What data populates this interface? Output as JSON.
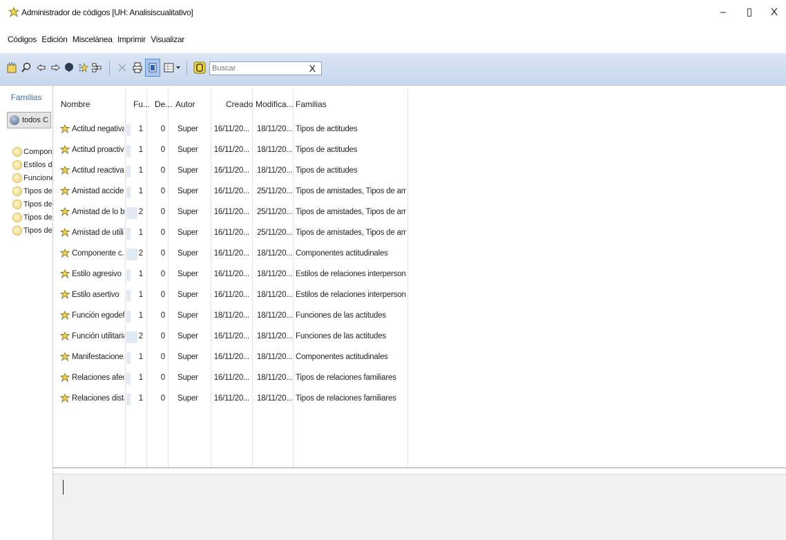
{
  "window": {
    "title": "Administrador de códigos [UH: Analisiscualitativo]",
    "minimize": "–",
    "restore": "▯",
    "close": "X"
  },
  "menu": [
    "Códigos",
    "Edición",
    "Miscelánea",
    "Imprimir",
    "Visualizar"
  ],
  "toolbar": {
    "icons": [
      "new-code-icon",
      "find-icon",
      "back-icon",
      "forward-icon",
      "balloon-icon",
      "quotations-icon",
      "network-icon",
      "delete-icon",
      "print-icon",
      "view-single-icon",
      "view-grid-icon",
      "filter-icon"
    ],
    "search_placeholder": "Buscar",
    "search_clear": "X"
  },
  "sidebar": {
    "title": "Familias",
    "all_button": "todos C",
    "items": [
      "Compone",
      "Estilos de",
      "Funciones",
      "Tipos de a",
      "Tipos de a",
      "Tipos de a",
      "Tipos de r"
    ]
  },
  "table": {
    "headers": [
      "Nombre",
      "Fu...",
      "De...",
      "Autor",
      "Creado",
      "Modifica...",
      "Familias"
    ],
    "rows": [
      {
        "nombre": "Actitud negativa",
        "fu": "1",
        "de": "0",
        "autor": "Super",
        "creado": "16/11/20...",
        "modificado": "18/11/20...",
        "familias": "Tipos de actitudes"
      },
      {
        "nombre": "Actitud proactiva",
        "fu": "1",
        "de": "0",
        "autor": "Super",
        "creado": "16/11/20...",
        "modificado": "18/11/20...",
        "familias": "Tipos de actitudes"
      },
      {
        "nombre": "Actitud reactiva",
        "fu": "1",
        "de": "0",
        "autor": "Super",
        "creado": "16/11/20...",
        "modificado": "18/11/20...",
        "familias": "Tipos de actitudes"
      },
      {
        "nombre": "Amistad accide...",
        "fu": "1",
        "de": "0",
        "autor": "Super",
        "creado": "16/11/20...",
        "modificado": "25/11/20...",
        "familias": "Tipos de amistades, Tipos de ami..."
      },
      {
        "nombre": "Amistad de lo b...",
        "fu": "2",
        "de": "0",
        "autor": "Super",
        "creado": "16/11/20...",
        "modificado": "25/11/20...",
        "familias": "Tipos de amistades, Tipos de ami..."
      },
      {
        "nombre": "Amistad de utili...",
        "fu": "1",
        "de": "0",
        "autor": "Super",
        "creado": "16/11/20...",
        "modificado": "25/11/20...",
        "familias": "Tipos de amistades, Tipos de ami..."
      },
      {
        "nombre": "Componente c...",
        "fu": "2",
        "de": "0",
        "autor": "Super",
        "creado": "16/11/20...",
        "modificado": "18/11/20...",
        "familias": "Componentes actitudinales"
      },
      {
        "nombre": "Estilo agresivo",
        "fu": "1",
        "de": "0",
        "autor": "Super",
        "creado": "16/11/20...",
        "modificado": "18/11/20...",
        "familias": "Estilos de relaciones interpersonal..."
      },
      {
        "nombre": "Estilo asertivo",
        "fu": "1",
        "de": "0",
        "autor": "Super",
        "creado": "16/11/20...",
        "modificado": "18/11/20...",
        "familias": "Estilos de relaciones interpersonal..."
      },
      {
        "nombre": "Función egodef...",
        "fu": "1",
        "de": "0",
        "autor": "Super",
        "creado": "18/11/20...",
        "modificado": "18/11/20...",
        "familias": "Funciones de las actitudes"
      },
      {
        "nombre": "Función utilitaria",
        "fu": "2",
        "de": "0",
        "autor": "Super",
        "creado": "16/11/20...",
        "modificado": "18/11/20...",
        "familias": "Funciones de las actitudes"
      },
      {
        "nombre": "Manifestacione...",
        "fu": "1",
        "de": "0",
        "autor": "Super",
        "creado": "16/11/20...",
        "modificado": "18/11/20...",
        "familias": "Componentes actitudinales"
      },
      {
        "nombre": "Relaciones afect...",
        "fu": "1",
        "de": "0",
        "autor": "Super",
        "creado": "16/11/20...",
        "modificado": "18/11/20...",
        "familias": "Tipos de relaciones familiares"
      },
      {
        "nombre": "Relaciones dista...",
        "fu": "1",
        "de": "0",
        "autor": "Super",
        "creado": "16/11/20...",
        "modificado": "18/11/20...",
        "familias": "Tipos de relaciones familiares"
      }
    ]
  },
  "colors": {
    "toolbar_bg": "#d2dff2",
    "sidebar_title": "#3f6e9e",
    "code_icon": "#e4c443",
    "bar": "#e1e9f3"
  }
}
